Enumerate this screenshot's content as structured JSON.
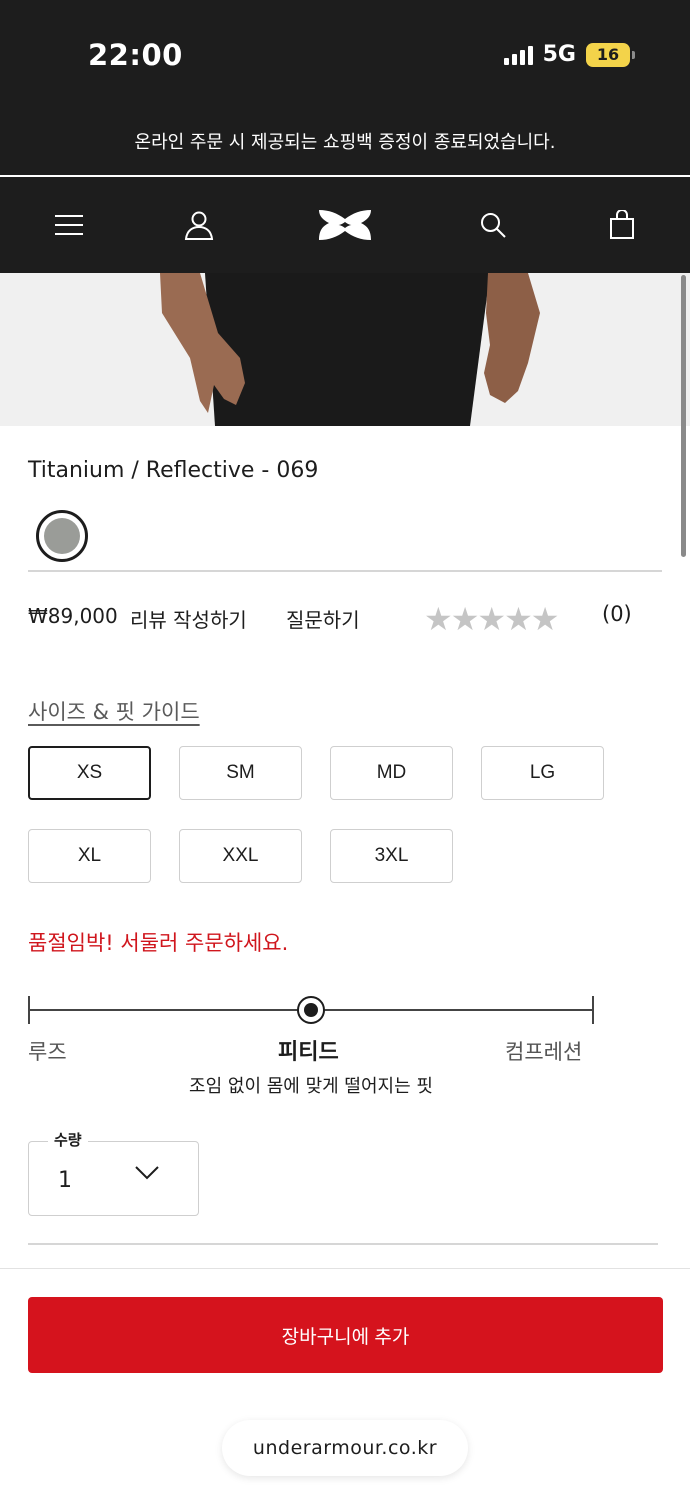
{
  "status_bar": {
    "time": "22:00",
    "network": "5G",
    "battery": "16"
  },
  "promo": {
    "text": "온라인 주문 시 제공되는 쇼핑백 증정이 종료되었습니다."
  },
  "nav": {
    "icons": [
      "menu-icon",
      "account-icon",
      "under-armour-logo",
      "search-icon",
      "shopping-bag-icon"
    ]
  },
  "product": {
    "color_name": "Titanium / Reflective -  069",
    "swatch_color": "#9a9c98",
    "price": "₩89,000",
    "write_review": "리뷰 작성하기",
    "ask_question": "질문하기",
    "rating": 0,
    "rating_max": 5,
    "review_count": "(0)"
  },
  "sizes": {
    "guide_label": "사이즈 & 핏 가이드",
    "options": [
      "XS",
      "SM",
      "MD",
      "LG",
      "XL",
      "XXL",
      "3XL"
    ],
    "selected": "XS"
  },
  "urgency": {
    "text": "품절임박! 서둘러 주문하세요."
  },
  "fit": {
    "loose": "루즈",
    "fitted": "피티드",
    "compression": "컴프레션",
    "description": "조임 없이 몸에 맞게 떨어지는 핏",
    "selected": "피티드"
  },
  "quantity": {
    "label": "수량",
    "value": "1"
  },
  "cart": {
    "button_label": "장바구니에 추가"
  },
  "browser": {
    "url": "underarmour.co.kr"
  },
  "colors": {
    "accent_red": "#d5131d",
    "urgency_red": "#d0161d",
    "header_bg": "#1d1d1d"
  }
}
